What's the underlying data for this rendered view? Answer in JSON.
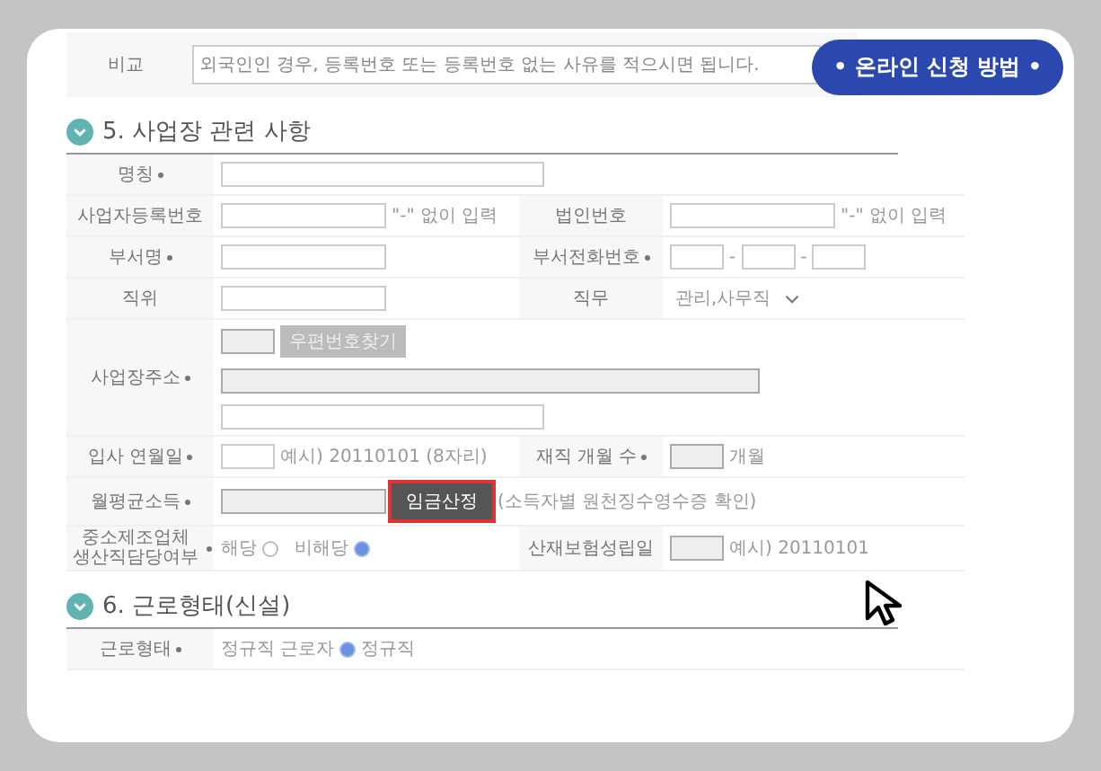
{
  "remark": {
    "label": "비교",
    "placeholder": "외국인인 경우, 등록번호 또는 등록번호 없는 사유를 적으시면 됩니다."
  },
  "help_badge": "• 온라인 신청 방법 •",
  "sections": [
    {
      "title": "5. 사업장 관련 사항",
      "rows": [
        {
          "cells": [
            {
              "label": "명칭",
              "required": true,
              "controls": [
                {
                  "kind": "input-long",
                  "disabled": false
                }
              ]
            }
          ]
        },
        {
          "cells": [
            {
              "label": "사업자등록번호",
              "required": false,
              "controls": [
                {
                  "kind": "input-mid",
                  "disabled": false
                },
                {
                  "kind": "note",
                  "text": "\"-\" 없이 입력"
                }
              ]
            },
            {
              "label": "법인번호",
              "required": false,
              "controls": [
                {
                  "kind": "input-mid",
                  "disabled": false
                },
                {
                  "kind": "note",
                  "text": "\"-\" 없이 입력"
                }
              ]
            }
          ]
        },
        {
          "cells": [
            {
              "label": "부서명",
              "required": true,
              "controls": [
                {
                  "kind": "input-mid",
                  "disabled": false
                }
              ]
            },
            {
              "label": "부서전화번호",
              "required": true,
              "controls": [
                {
                  "kind": "input-small",
                  "disabled": false
                },
                {
                  "kind": "note",
                  "text": "-"
                },
                {
                  "kind": "input-small",
                  "disabled": false
                },
                {
                  "kind": "note",
                  "text": "-"
                },
                {
                  "kind": "input-small",
                  "disabled": false
                }
              ]
            }
          ]
        },
        {
          "cells": [
            {
              "label": "직위",
              "required": false,
              "controls": [
                {
                  "kind": "input-mid",
                  "disabled": false
                }
              ]
            },
            {
              "label": "직무",
              "required": false,
              "controls": [
                {
                  "kind": "select",
                  "value": "관리,사무직"
                }
              ]
            }
          ]
        },
        {
          "cells": [
            {
              "label": "사업장주소",
              "required": true,
              "controls": [
                {
                  "kind": "input-small",
                  "disabled": true
                },
                {
                  "kind": "button",
                  "text": "우편번호찾기",
                  "disabled": true,
                  "highlighted": false
                },
                {
                  "kind": "break"
                },
                {
                  "kind": "input-full",
                  "disabled": true
                },
                {
                  "kind": "break"
                },
                {
                  "kind": "input-long",
                  "disabled": false
                }
              ]
            }
          ]
        },
        {
          "cells": [
            {
              "label": "입사 연월일",
              "required": true,
              "controls": [
                {
                  "kind": "input-small",
                  "disabled": false
                },
                {
                  "kind": "note",
                  "text": "예시) 20110101 (8자리)"
                }
              ]
            },
            {
              "label": "재직 개월 수",
              "required": true,
              "controls": [
                {
                  "kind": "input-small",
                  "disabled": true
                },
                {
                  "kind": "note",
                  "text": "개월"
                }
              ]
            }
          ]
        },
        {
          "cells": [
            {
              "label": "월평균소득",
              "required": true,
              "controls": [
                {
                  "kind": "input-mid",
                  "disabled": true
                },
                {
                  "kind": "button",
                  "text": "임금산정",
                  "disabled": false,
                  "highlighted": true
                },
                {
                  "kind": "note",
                  "text": "(소득자별 원천징수영수증 확인)"
                }
              ]
            }
          ]
        },
        {
          "cells": [
            {
              "label": "중소제조업체 생산직담당여부",
              "required": true,
              "controls": [
                {
                  "kind": "radio",
                  "text": "해당",
                  "selected": false,
                  "label_first": true
                },
                {
                  "kind": "radio",
                  "text": "비해당",
                  "selected": true,
                  "label_first": true
                }
              ]
            },
            {
              "label": "산재보험성립일",
              "required": false,
              "controls": [
                {
                  "kind": "input-small",
                  "disabled": true
                },
                {
                  "kind": "note",
                  "text": "예시) 20110101"
                }
              ]
            }
          ]
        }
      ]
    },
    {
      "title": "6. 근로형태(신설)",
      "rows": [
        {
          "cells": [
            {
              "label": "근로형태",
              "required": true,
              "controls": [
                {
                  "kind": "note",
                  "text": "정규직 근로자"
                },
                {
                  "kind": "radio",
                  "text": "정규직",
                  "selected": true,
                  "label_first": false
                }
              ]
            }
          ]
        }
      ]
    }
  ]
}
